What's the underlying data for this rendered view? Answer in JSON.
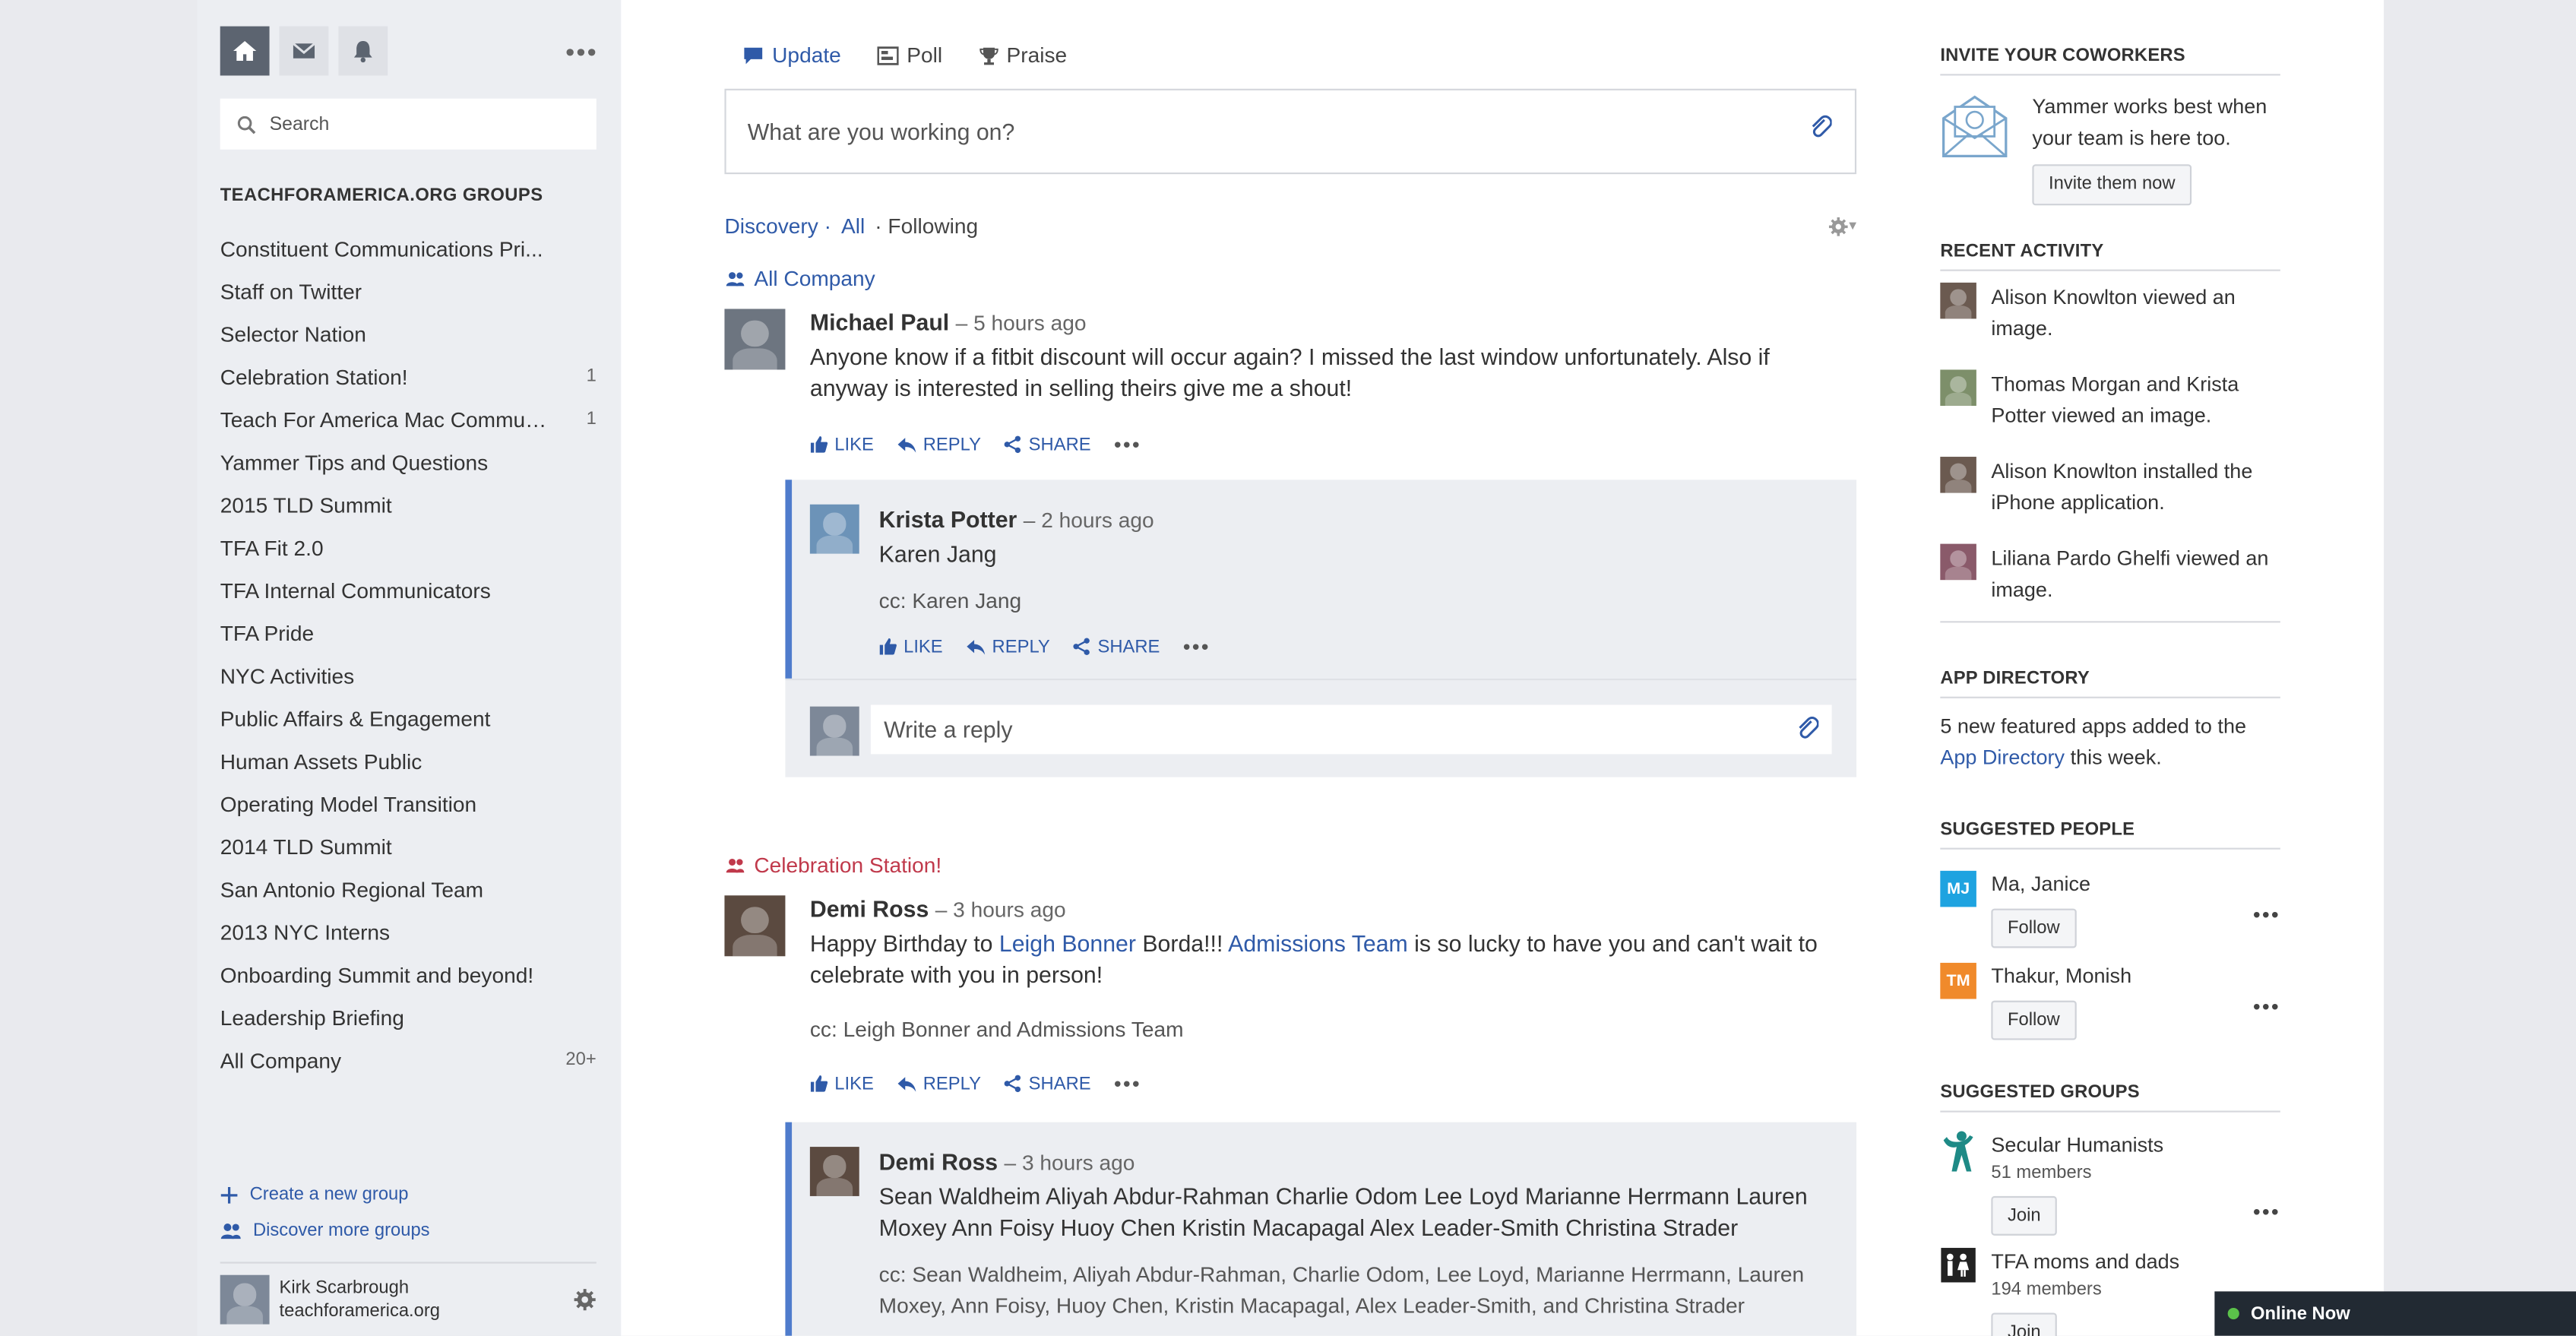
{
  "sidebar": {
    "search_placeholder": "Search",
    "groups_header": "TEACHFORAMERICA.ORG GROUPS",
    "groups": [
      {
        "name": "Constituent Communications Pri...",
        "count": ""
      },
      {
        "name": "Staff on Twitter",
        "count": ""
      },
      {
        "name": "Selector Nation",
        "count": ""
      },
      {
        "name": "Celebration Station!",
        "count": "1"
      },
      {
        "name": "Teach For America Mac Commun...",
        "count": "1"
      },
      {
        "name": "Yammer Tips and Questions",
        "count": ""
      },
      {
        "name": "2015 TLD Summit",
        "count": ""
      },
      {
        "name": "TFA Fit 2.0",
        "count": ""
      },
      {
        "name": "TFA Internal Communicators",
        "count": ""
      },
      {
        "name": "TFA Pride",
        "count": ""
      },
      {
        "name": "NYC Activities",
        "count": ""
      },
      {
        "name": "Public Affairs & Engagement",
        "count": ""
      },
      {
        "name": "Human Assets Public",
        "count": ""
      },
      {
        "name": "Operating Model Transition",
        "count": ""
      },
      {
        "name": "2014 TLD Summit",
        "count": ""
      },
      {
        "name": "San Antonio Regional Team",
        "count": ""
      },
      {
        "name": "2013 NYC Interns",
        "count": ""
      },
      {
        "name": "Onboarding Summit and beyond!",
        "count": ""
      },
      {
        "name": "Leadership Briefing",
        "count": ""
      },
      {
        "name": "All Company",
        "count": "20+"
      }
    ],
    "create_group": "Create a new group",
    "discover_groups": "Discover more groups",
    "user_name": "Kirk Scarbrough",
    "user_org": "teachforamerica.org"
  },
  "publisher": {
    "tabs": [
      "Update",
      "Poll",
      "Praise"
    ],
    "placeholder": "What are you working on?"
  },
  "filters": {
    "discovery": "Discovery",
    "all": "All",
    "following": "Following"
  },
  "feed": {
    "thread1": {
      "group": "All Company",
      "author": "Michael Paul",
      "time": "– 5 hours ago",
      "text1": "Anyone know if a fitbit discount will occur again? I missed the last window unfortunately. Also if",
      "text2": "anyway is interested in selling theirs give me a shout!",
      "reply": {
        "author": "Krista Potter",
        "time": "– 2 hours ago",
        "mention": "Karen Jang",
        "cc": "cc: Karen Jang"
      },
      "reply_placeholder": "Write a reply"
    },
    "thread2": {
      "group": "Celebration Station!",
      "author": "Demi Ross",
      "time": "– 3 hours ago",
      "text_a": "Happy Birthday to ",
      "link_a": "Leigh Bonner",
      "text_b": " Borda!!! ",
      "link_b": "Admissions Team",
      "text_c": " is so lucky to have you and can't wait to",
      "text_d": "celebrate with you in person!",
      "cc": "cc: Leigh Bonner and Admissions Team",
      "reply": {
        "author": "Demi Ross",
        "time": "– 3 hours ago",
        "mentions1": "Sean Waldheim Aliyah Abdur-Rahman Charlie Odom Lee Loyd Marianne Herrmann Lauren",
        "mentions2": "Moxey Ann Foisy Huoy Chen Kristin Macapagal Alex Leader-Smith Christina Strader",
        "cc1": "cc: Sean Waldheim, Aliyah Abdur-Rahman, Charlie Odom, Lee Loyd, Marianne Herrmann, Lauren",
        "cc2": "Moxey, Ann Foisy, Huoy Chen, Kristin Macapagal, Alex Leader-Smith, and Christina Strader"
      }
    },
    "actions": {
      "like": "LIKE",
      "reply": "REPLY",
      "share": "SHARE"
    }
  },
  "right": {
    "invite_title": "INVITE YOUR COWORKERS",
    "invite_text": "Yammer works best when your team is here too.",
    "invite_button": "Invite them now",
    "recent_title": "RECENT ACTIVITY",
    "recent": [
      "Alison Knowlton viewed an image.",
      "Thomas Morgan and Krista Potter viewed an image.",
      "Alison Knowlton installed the iPhone application.",
      "Liliana Pardo Ghelfi viewed an image."
    ],
    "appdir_title": "APP DIRECTORY",
    "appdir_text1": "5 new featured apps added to the",
    "appdir_link": "App Directory",
    "appdir_text2": " this week.",
    "people_title": "SUGGESTED PEOPLE",
    "people": [
      {
        "initials": "MJ",
        "name": "Ma, Janice",
        "button": "Follow",
        "color": "#1ea3e0"
      },
      {
        "initials": "TM",
        "name": "Thakur, Monish",
        "button": "Follow",
        "color": "#f08a2b"
      }
    ],
    "groups_title": "SUGGESTED GROUPS",
    "sgroups": [
      {
        "name": "Secular Humanists",
        "members": "51 members",
        "button": "Join"
      },
      {
        "name": "TFA moms and dads",
        "members": "194 members",
        "button": "Join"
      }
    ]
  },
  "online": "Online Now"
}
